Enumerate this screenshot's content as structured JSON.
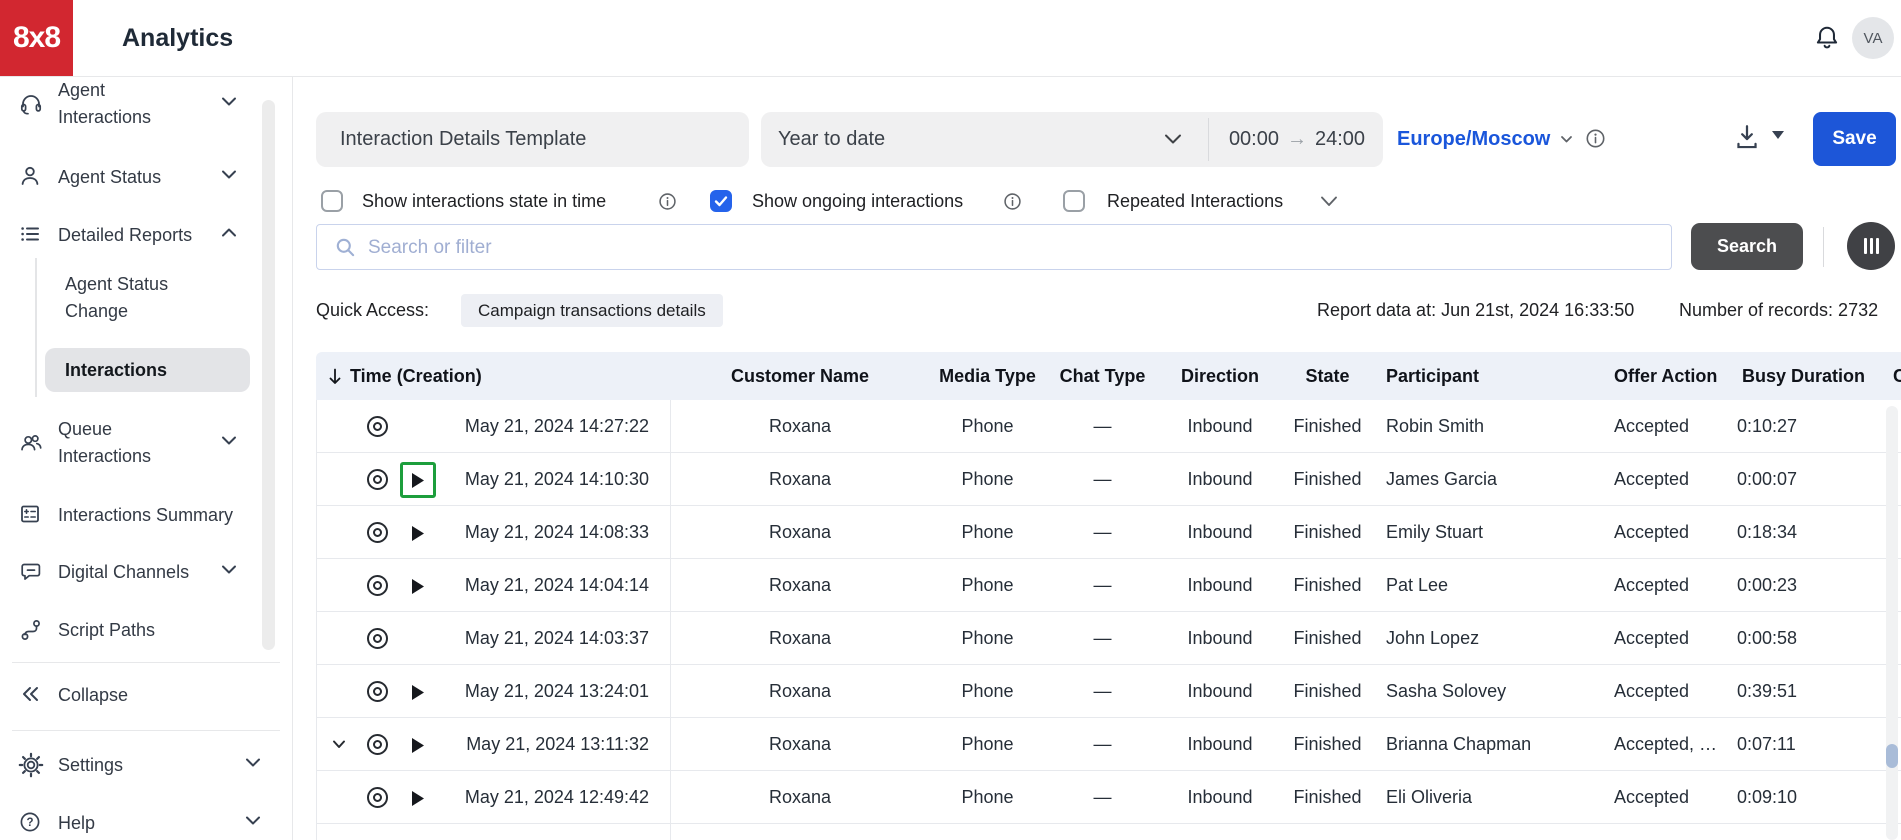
{
  "topbar": {
    "logo_text": "8x8",
    "title": "Analytics",
    "avatar_initials": "VA",
    "icons": [
      "bell-icon",
      "avatar"
    ]
  },
  "sidebar": {
    "items": [
      {
        "label": "Agent Interactions",
        "icon": "headset-icon",
        "chevron": "down"
      },
      {
        "label": "Agent Status",
        "icon": "person-icon",
        "chevron": "down"
      },
      {
        "label": "Detailed Reports",
        "icon": "detailed-list-icon",
        "chevron": "up",
        "expanded": true,
        "children": [
          {
            "label": "Agent Status Change",
            "selected": false
          },
          {
            "label": "Interactions",
            "selected": true
          }
        ]
      },
      {
        "label": "Queue Interactions",
        "icon": "people-icon",
        "chevron": "down"
      },
      {
        "label": "Interactions Summary",
        "icon": "summary-icon"
      },
      {
        "label": "Digital Channels",
        "icon": "chat-bubble-icon",
        "chevron": "down"
      },
      {
        "label": "Script Paths",
        "icon": "flow-icon"
      }
    ],
    "collapse_label": "Collapse",
    "settings_label": "Settings",
    "help_label": "Help"
  },
  "filters": {
    "template_name": "Interaction Details Template",
    "date_range_label": "Year to date",
    "time_from": "00:00",
    "time_separator": "→",
    "time_to": "24:00",
    "timezone": "Europe/Moscow",
    "save_label": "Save",
    "checkboxes": [
      {
        "label": "Show interactions state in time",
        "checked": false,
        "info": true
      },
      {
        "label": "Show ongoing interactions",
        "checked": true,
        "info": true
      },
      {
        "label": "Repeated Interactions",
        "checked": false,
        "chevron": true
      }
    ],
    "search_placeholder": "Search or filter",
    "search_button_label": "Search"
  },
  "quick_access": {
    "label": "Quick Access:",
    "chips": [
      "Campaign transactions details"
    ]
  },
  "report_meta": {
    "data_at_label": "Report data at: Jun 21st, 2024 16:33:50",
    "records_label": "Number of records: 2732"
  },
  "table": {
    "sort": {
      "column": "Time (Creation)",
      "direction": "desc"
    },
    "columns": [
      "Time (Creation)",
      "Customer Name",
      "Media Type",
      "Chat Type",
      "Direction",
      "State",
      "Participant",
      "Offer Action",
      "Busy Duration",
      "C"
    ],
    "rows": [
      {
        "time": "May 21, 2024 14:27:22",
        "customer": "Roxana",
        "media_type": "Phone",
        "chat_type": "—",
        "direction": "Inbound",
        "state": "Finished",
        "participant": "Robin Smith",
        "offer_action": "Accepted",
        "busy_duration": "0:10:27",
        "controls": [
          "eye"
        ],
        "play_selected": false
      },
      {
        "time": "May 21, 2024 14:10:30",
        "customer": "Roxana",
        "media_type": "Phone",
        "chat_type": "—",
        "direction": "Inbound",
        "state": "Finished",
        "participant": "James Garcia",
        "offer_action": "Accepted",
        "busy_duration": "0:00:07",
        "controls": [
          "eye",
          "play"
        ],
        "play_selected": true
      },
      {
        "time": "May 21, 2024 14:08:33",
        "customer": "Roxana",
        "media_type": "Phone",
        "chat_type": "—",
        "direction": "Inbound",
        "state": "Finished",
        "participant": "Emily Stuart",
        "offer_action": "Accepted",
        "busy_duration": "0:18:34",
        "controls": [
          "eye",
          "play"
        ],
        "play_selected": false
      },
      {
        "time": "May 21, 2024 14:04:14",
        "customer": "Roxana",
        "media_type": "Phone",
        "chat_type": "—",
        "direction": "Inbound",
        "state": "Finished",
        "participant": "Pat Lee",
        "offer_action": "Accepted",
        "busy_duration": "0:00:23",
        "controls": [
          "eye",
          "play"
        ],
        "play_selected": false
      },
      {
        "time": "May 21, 2024 14:03:37",
        "customer": "Roxana",
        "media_type": "Phone",
        "chat_type": "—",
        "direction": "Inbound",
        "state": "Finished",
        "participant": "John Lopez",
        "offer_action": "Accepted",
        "busy_duration": "0:00:58",
        "controls": [
          "eye"
        ],
        "play_selected": false
      },
      {
        "time": "May 21, 2024 13:24:01",
        "customer": "Roxana",
        "media_type": "Phone",
        "chat_type": "—",
        "direction": "Inbound",
        "state": "Finished",
        "participant": "Sasha Solovey",
        "offer_action": "Accepted",
        "busy_duration": "0:39:51",
        "controls": [
          "eye",
          "play"
        ],
        "play_selected": false
      },
      {
        "time": "May 21, 2024 13:11:32",
        "customer": "Roxana",
        "media_type": "Phone",
        "chat_type": "—",
        "direction": "Inbound",
        "state": "Finished",
        "participant": "Brianna Chapman",
        "offer_action": "Accepted, …",
        "busy_duration": "0:07:11",
        "controls": [
          "expand",
          "eye",
          "play"
        ],
        "play_selected": false
      },
      {
        "time": "May 21, 2024 12:49:42",
        "customer": "Roxana",
        "media_type": "Phone",
        "chat_type": "—",
        "direction": "Inbound",
        "state": "Finished",
        "participant": "Eli Oliveria",
        "offer_action": "Accepted",
        "busy_duration": "0:09:10",
        "controls": [
          "eye",
          "play"
        ],
        "play_selected": false
      }
    ]
  },
  "colors": {
    "brand_red": "#d22730",
    "accent_blue": "#1d56d8",
    "link_blue": "#1a56db",
    "checkbox_blue": "#2563eb",
    "selected_play_green": "#1d9e3c",
    "table_header_bg": "#edf1f8",
    "dark_button": "#4c4d4f"
  }
}
